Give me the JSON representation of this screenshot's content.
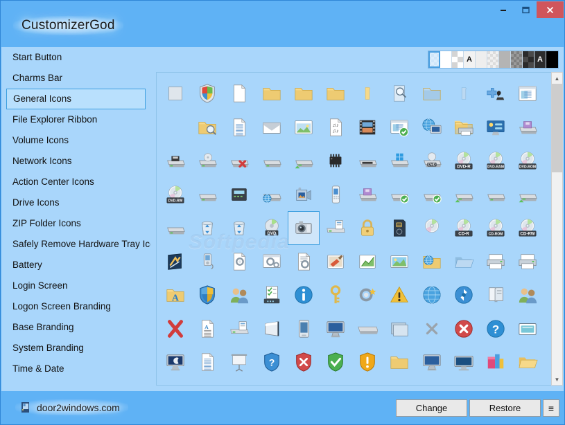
{
  "window": {
    "title": "CustomizerGod",
    "controls": [
      {
        "name": "minimize-button",
        "glyph": "–"
      },
      {
        "name": "maximize-button",
        "glyph": "❐"
      },
      {
        "name": "close-button",
        "glyph": "✕"
      }
    ]
  },
  "sidebar": {
    "items": [
      {
        "label": "Start Button",
        "selected": false
      },
      {
        "label": "Charms Bar",
        "selected": false
      },
      {
        "label": "General Icons",
        "selected": true
      },
      {
        "label": "File Explorer Ribbon",
        "selected": false
      },
      {
        "label": "Volume Icons",
        "selected": false
      },
      {
        "label": "Network Icons",
        "selected": false
      },
      {
        "label": "Action Center Icons",
        "selected": false
      },
      {
        "label": "Drive Icons",
        "selected": false
      },
      {
        "label": "ZIP Folder Icons",
        "selected": false
      },
      {
        "label": "Safely Remove Hardware Tray Icon",
        "selected": false
      },
      {
        "label": "Battery",
        "selected": false
      },
      {
        "label": "Login Screen",
        "selected": false
      },
      {
        "label": "Logon Screen Branding",
        "selected": false
      },
      {
        "label": "Base Branding",
        "selected": false
      },
      {
        "label": "System Branding",
        "selected": false
      },
      {
        "label": "Time & Date",
        "selected": false
      }
    ]
  },
  "background_swatches": {
    "selected_index": 0,
    "items": [
      {
        "name": "swatch-light-blue-checker",
        "kind": "checker",
        "c1": "#dceefc",
        "c2": "#cfe6fa",
        "label": ""
      },
      {
        "name": "swatch-white",
        "kind": "solid",
        "c1": "#ffffff",
        "c2": "#ffffff",
        "label": ""
      },
      {
        "name": "swatch-white-checker",
        "kind": "bigchecker",
        "c1": "#ffffff",
        "c2": "#d4d4d4",
        "label": ""
      },
      {
        "name": "swatch-white-letter-a",
        "kind": "solid",
        "c1": "#f2f2f2",
        "c2": "#f2f2f2",
        "label": "A"
      },
      {
        "name": "swatch-offwhite",
        "kind": "solid",
        "c1": "#eeeeee",
        "c2": "#eeeeee",
        "label": ""
      },
      {
        "name": "swatch-light-gray-checker",
        "kind": "checker",
        "c1": "#f0f0f0",
        "c2": "#dcdcdc",
        "label": ""
      },
      {
        "name": "swatch-gray",
        "kind": "solid",
        "c1": "#b4b4b4",
        "c2": "#b4b4b4",
        "label": ""
      },
      {
        "name": "swatch-dark-gray-checker",
        "kind": "checker",
        "c1": "#9a9a9a",
        "c2": "#7e7e7e",
        "label": ""
      },
      {
        "name": "swatch-dark-checker",
        "kind": "bigchecker",
        "c1": "#4a4a4a",
        "c2": "#2b2b2b",
        "label": ""
      },
      {
        "name": "swatch-dark-letter-a",
        "kind": "solid",
        "c1": "#2c2c2c",
        "c2": "#2c2c2c",
        "label": "A"
      },
      {
        "name": "swatch-black",
        "kind": "solid",
        "c1": "#000000",
        "c2": "#000000",
        "label": ""
      }
    ]
  },
  "grid": {
    "watermark": "Softpedia",
    "selected_index": 52,
    "icons": [
      {
        "name": "icon-desktop-wallpaper",
        "glyph": "🖼",
        "label": ""
      },
      {
        "name": "icon-security-shield-color",
        "glyph": "shield-quad",
        "label": ""
      },
      {
        "name": "icon-blank-document",
        "glyph": "doc-blank",
        "label": ""
      },
      {
        "name": "icon-folder-closed",
        "glyph": "folder",
        "label": ""
      },
      {
        "name": "icon-folder-closed-2",
        "glyph": "folder",
        "label": ""
      },
      {
        "name": "icon-folder-closed-3",
        "glyph": "folder",
        "label": ""
      },
      {
        "name": "icon-folder-thin",
        "glyph": "folder-thin",
        "label": ""
      },
      {
        "name": "icon-search-document",
        "glyph": "doc-search",
        "label": ""
      },
      {
        "name": "icon-folder-blue-open",
        "glyph": "folder-blue",
        "label": ""
      },
      {
        "name": "icon-folder-blue-thin",
        "glyph": "folder-blue-thin",
        "label": ""
      },
      {
        "name": "icon-games-chess",
        "glyph": "chess",
        "label": ""
      },
      {
        "name": "icon-window-list",
        "glyph": "window",
        "label": ""
      },
      {
        "name": "icon-empty-slot",
        "glyph": "empty",
        "label": ""
      },
      {
        "name": "icon-folder-search",
        "glyph": "folder-search",
        "label": ""
      },
      {
        "name": "icon-text-document",
        "glyph": "doc-lines",
        "label": ""
      },
      {
        "name": "icon-mail-envelope",
        "glyph": "envelope",
        "label": ""
      },
      {
        "name": "icon-picture-window",
        "glyph": "picture",
        "label": ""
      },
      {
        "name": "icon-music-sheet",
        "glyph": "music-doc",
        "label": ""
      },
      {
        "name": "icon-film-strip",
        "glyph": "film",
        "label": ""
      },
      {
        "name": "icon-window-check",
        "glyph": "window-check",
        "label": ""
      },
      {
        "name": "icon-network-globe-pc",
        "glyph": "globe-pc",
        "label": ""
      },
      {
        "name": "icon-printer-folder",
        "glyph": "printer-folder",
        "label": ""
      },
      {
        "name": "icon-control-panel",
        "glyph": "control-panel",
        "label": ""
      },
      {
        "name": "icon-floppy-drive-purple",
        "glyph": "drive-purple",
        "label": ""
      },
      {
        "name": "icon-floppy-drive",
        "glyph": "drive-floppy",
        "label": ""
      },
      {
        "name": "icon-cd-drive",
        "glyph": "drive-cd",
        "label": ""
      },
      {
        "name": "icon-drive-disconnect",
        "glyph": "drive-x",
        "label": ""
      },
      {
        "name": "icon-hard-drive",
        "glyph": "drive-plain",
        "label": ""
      },
      {
        "name": "icon-network-drive",
        "glyph": "drive-net",
        "label": ""
      },
      {
        "name": "icon-memory-chip",
        "glyph": "chip",
        "label": ""
      },
      {
        "name": "icon-drive-dark",
        "glyph": "drive-dark",
        "label": ""
      },
      {
        "name": "icon-windows-drive",
        "glyph": "drive-win",
        "label": ""
      },
      {
        "name": "icon-dvd-drive",
        "glyph": "drive-dvd",
        "label": "DVD"
      },
      {
        "name": "icon-dvd-r-disc",
        "glyph": "disc-label",
        "label": "DVD-R"
      },
      {
        "name": "icon-dvd-ram-disc",
        "glyph": "disc-label",
        "label": "DVD-RAM"
      },
      {
        "name": "icon-dvd-rom-disc",
        "glyph": "disc-label",
        "label": "DVD-ROM"
      },
      {
        "name": "icon-dvd-rw-disc",
        "glyph": "disc-label",
        "label": "DVD-RW"
      },
      {
        "name": "icon-hard-drive-2",
        "glyph": "drive-plain",
        "label": ""
      },
      {
        "name": "icon-server-rack",
        "glyph": "server",
        "label": ""
      },
      {
        "name": "icon-web-drive",
        "glyph": "drive-globe",
        "label": ""
      },
      {
        "name": "icon-camcorder",
        "glyph": "camcorder",
        "label": ""
      },
      {
        "name": "icon-mobile-phone",
        "glyph": "phone",
        "label": ""
      },
      {
        "name": "icon-floppy-drive-2",
        "glyph": "drive-purple",
        "label": ""
      },
      {
        "name": "icon-drive-check",
        "glyph": "drive-check",
        "label": ""
      },
      {
        "name": "icon-drive-check-2",
        "glyph": "drive-check",
        "label": ""
      },
      {
        "name": "icon-drive-net-2",
        "glyph": "drive-net",
        "label": ""
      },
      {
        "name": "icon-drive-plain-2",
        "glyph": "drive-plain",
        "label": ""
      },
      {
        "name": "icon-drive-net-3",
        "glyph": "drive-net",
        "label": ""
      },
      {
        "name": "icon-drive-gray",
        "glyph": "drive-plain",
        "label": ""
      },
      {
        "name": "icon-recycle-bin-full",
        "glyph": "recycle",
        "label": ""
      },
      {
        "name": "icon-recycle-bin-empty",
        "glyph": "recycle",
        "label": ""
      },
      {
        "name": "icon-dvd-disc-label",
        "glyph": "disc-dvd-flat",
        "label": "DVD"
      },
      {
        "name": "icon-digital-camera",
        "glyph": "camera",
        "label": ""
      },
      {
        "name": "icon-scanner",
        "glyph": "scanner",
        "label": ""
      },
      {
        "name": "icon-padlock",
        "glyph": "padlock",
        "label": ""
      },
      {
        "name": "icon-memory-card",
        "glyph": "memcard",
        "label": ""
      },
      {
        "name": "icon-blank-disc",
        "glyph": "disc-plain",
        "label": ""
      },
      {
        "name": "icon-cd-r-disc",
        "glyph": "disc-label",
        "label": "CD-R"
      },
      {
        "name": "icon-cd-rom-disc",
        "glyph": "disc-label",
        "label": "CD-ROM"
      },
      {
        "name": "icon-cd-rw-disc",
        "glyph": "disc-label",
        "label": "CD-RW"
      },
      {
        "name": "icon-paint-canvas",
        "glyph": "canvas",
        "label": ""
      },
      {
        "name": "icon-media-player-device",
        "glyph": "mp3",
        "label": ""
      },
      {
        "name": "icon-settings-document",
        "glyph": "doc-gear",
        "label": ""
      },
      {
        "name": "icon-settings-window",
        "glyph": "window-gear",
        "label": ""
      },
      {
        "name": "icon-settings-file",
        "glyph": "doc-gear2",
        "label": ""
      },
      {
        "name": "icon-paint-brush",
        "glyph": "brush",
        "label": ""
      },
      {
        "name": "icon-chart-document",
        "glyph": "chart",
        "label": ""
      },
      {
        "name": "icon-photo-landscape",
        "glyph": "photo",
        "label": ""
      },
      {
        "name": "icon-globe-folder",
        "glyph": "globe-folder",
        "label": ""
      },
      {
        "name": "icon-folder-open-blue",
        "glyph": "folder-open",
        "label": ""
      },
      {
        "name": "icon-printer-device",
        "glyph": "printer",
        "label": ""
      },
      {
        "name": "icon-printer-device-2",
        "glyph": "printer",
        "label": ""
      },
      {
        "name": "icon-fonts-folder",
        "glyph": "folder-font",
        "label": ""
      },
      {
        "name": "icon-shield-blue-yellow",
        "glyph": "shield-uac",
        "label": ""
      },
      {
        "name": "icon-user-accounts",
        "glyph": "users",
        "label": ""
      },
      {
        "name": "icon-task-checklist",
        "glyph": "checklist",
        "label": ""
      },
      {
        "name": "icon-information",
        "glyph": "info",
        "label": ""
      },
      {
        "name": "icon-key",
        "glyph": "key",
        "label": ""
      },
      {
        "name": "icon-settings-gear-star",
        "glyph": "gear-star",
        "label": ""
      },
      {
        "name": "icon-warning-triangle",
        "glyph": "warning",
        "label": ""
      },
      {
        "name": "icon-globe-network",
        "glyph": "globe",
        "label": ""
      },
      {
        "name": "icon-sync-refresh",
        "glyph": "sync",
        "label": ""
      },
      {
        "name": "icon-book-help",
        "glyph": "book",
        "label": ""
      },
      {
        "name": "icon-users-group",
        "glyph": "users",
        "label": ""
      },
      {
        "name": "icon-delete-red-x",
        "glyph": "red-x",
        "label": ""
      },
      {
        "name": "icon-document-formatted",
        "glyph": "doc-text",
        "label": ""
      },
      {
        "name": "icon-scanner-2",
        "glyph": "scanner",
        "label": ""
      },
      {
        "name": "icon-banner-panel",
        "glyph": "banner",
        "label": ""
      },
      {
        "name": "icon-pda-device",
        "glyph": "pda",
        "label": ""
      },
      {
        "name": "icon-monitor-blue",
        "glyph": "monitor-blue",
        "label": ""
      },
      {
        "name": "icon-drive-wide",
        "glyph": "drive-wide",
        "label": ""
      },
      {
        "name": "icon-window-stack",
        "glyph": "win-stack",
        "label": ""
      },
      {
        "name": "icon-close-gray-x",
        "glyph": "gray-x",
        "label": ""
      },
      {
        "name": "icon-error-red-circle",
        "glyph": "error-circle",
        "label": ""
      },
      {
        "name": "icon-help-blue-circle",
        "glyph": "help-circle",
        "label": ""
      },
      {
        "name": "icon-window-teal",
        "glyph": "window-teal",
        "label": ""
      },
      {
        "name": "icon-monitor-screensaver",
        "glyph": "monitor-moon",
        "label": ""
      },
      {
        "name": "icon-notepad-document",
        "glyph": "doc-lines",
        "label": ""
      },
      {
        "name": "icon-presentation-screen",
        "glyph": "projector",
        "label": ""
      },
      {
        "name": "icon-help-shield",
        "glyph": "shield-help",
        "label": ""
      },
      {
        "name": "icon-error-shield",
        "glyph": "shield-error",
        "label": ""
      },
      {
        "name": "icon-success-shield",
        "glyph": "shield-ok",
        "label": ""
      },
      {
        "name": "icon-alert-shield",
        "glyph": "shield-alert",
        "label": ""
      },
      {
        "name": "icon-folder-yellow",
        "glyph": "folder",
        "label": ""
      },
      {
        "name": "icon-monitor-desktop",
        "glyph": "monitor-blue",
        "label": ""
      },
      {
        "name": "icon-monitor-wide",
        "glyph": "monitor-wide",
        "label": ""
      },
      {
        "name": "icon-colorful-blocks",
        "glyph": "blocks",
        "label": ""
      },
      {
        "name": "icon-folder-open-yellow",
        "glyph": "folder-open-y",
        "label": ""
      }
    ]
  },
  "bottom_bar": {
    "site_label": "door2windows.com",
    "change_label": "Change",
    "restore_label": "Restore",
    "menu_glyph": "≡"
  },
  "scrollbar": {
    "up_glyph": "▲",
    "down_glyph": "▼"
  },
  "colors": {
    "titlebar": "#5fb2f5",
    "panel": "#a9d6fb",
    "accent": "#3d9fe0",
    "close_button": "#d0555c"
  }
}
